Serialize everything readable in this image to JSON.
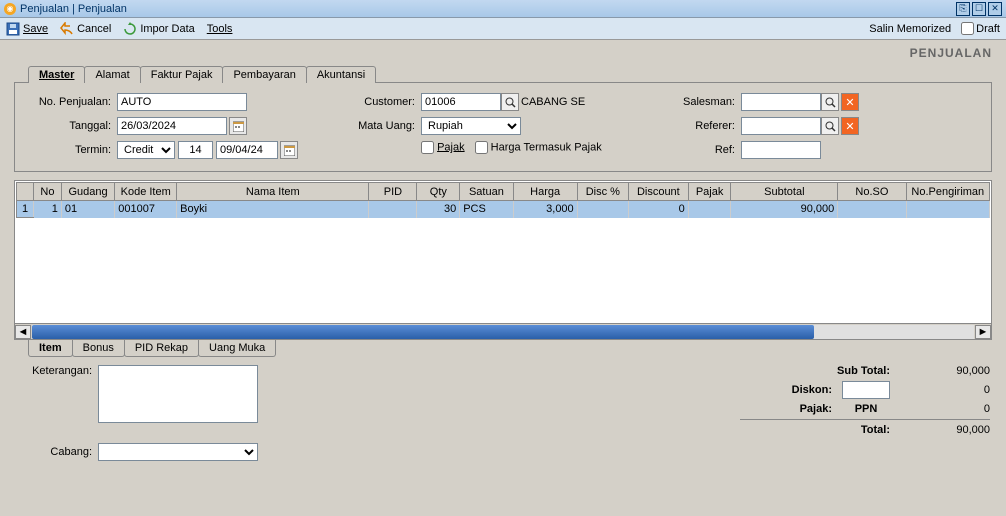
{
  "window": {
    "title": "Penjualan | Penjualan"
  },
  "toolbar": {
    "save": "Save",
    "cancel": "Cancel",
    "impor": "Impor Data",
    "tools": "Tools",
    "salin": "Salin Memorized",
    "draft": "Draft"
  },
  "module_title": "PENJUALAN",
  "tabs": {
    "master": "Master",
    "alamat": "Alamat",
    "faktur": "Faktur Pajak",
    "pembayaran": "Pembayaran",
    "akuntansi": "Akuntansi"
  },
  "form": {
    "no_penjualan_label": "No. Penjualan:",
    "no_penjualan": "AUTO",
    "tanggal_label": "Tanggal:",
    "tanggal": "26/03/2024",
    "termin_label": "Termin:",
    "termin_type": "Credit",
    "termin_days": "14",
    "termin_due": "09/04/24",
    "customer_label": "Customer:",
    "customer_code": "01006",
    "customer_name": "CABANG SE",
    "mata_uang_label": "Mata Uang:",
    "mata_uang": "Rupiah",
    "pajak_cb": "Pajak",
    "harga_termasuk_cb": "Harga Termasuk Pajak",
    "salesman_label": "Salesman:",
    "salesman": "",
    "referer_label": "Referer:",
    "referer": "",
    "ref_label": "Ref:",
    "ref": ""
  },
  "grid": {
    "headers": {
      "no": "No",
      "gudang": "Gudang",
      "kode": "Kode Item",
      "nama": "Nama Item",
      "pid": "PID",
      "qty": "Qty",
      "satuan": "Satuan",
      "harga": "Harga",
      "discpct": "Disc %",
      "discount": "Discount",
      "pajak": "Pajak",
      "subtotal": "Subtotal",
      "noso": "No.SO",
      "nopeng": "No.Pengiriman"
    },
    "rows": [
      {
        "idx": "1",
        "no": "1",
        "gudang": "01",
        "kode": "001007",
        "nama": "Boyki",
        "pid": "",
        "qty": "30",
        "satuan": "PCS",
        "harga": "3,000",
        "discpct": "",
        "discount": "0",
        "pajak": "",
        "subtotal": "90,000",
        "noso": "",
        "nopeng": ""
      }
    ]
  },
  "sub_tabs": {
    "item": "Item",
    "bonus": "Bonus",
    "pid": "PID Rekap",
    "uang": "Uang Muka"
  },
  "footer": {
    "keterangan_label": "Keterangan:",
    "keterangan": "",
    "cabang_label": "Cabang:",
    "cabang": "",
    "subtotal_label": "Sub Total:",
    "subtotal": "90,000",
    "diskon_label": "Diskon:",
    "diskon_input": "",
    "diskon_val": "0",
    "pajak_label": "Pajak:",
    "pajak_name": "PPN",
    "pajak_val": "0",
    "total_label": "Total:",
    "total": "90,000"
  }
}
